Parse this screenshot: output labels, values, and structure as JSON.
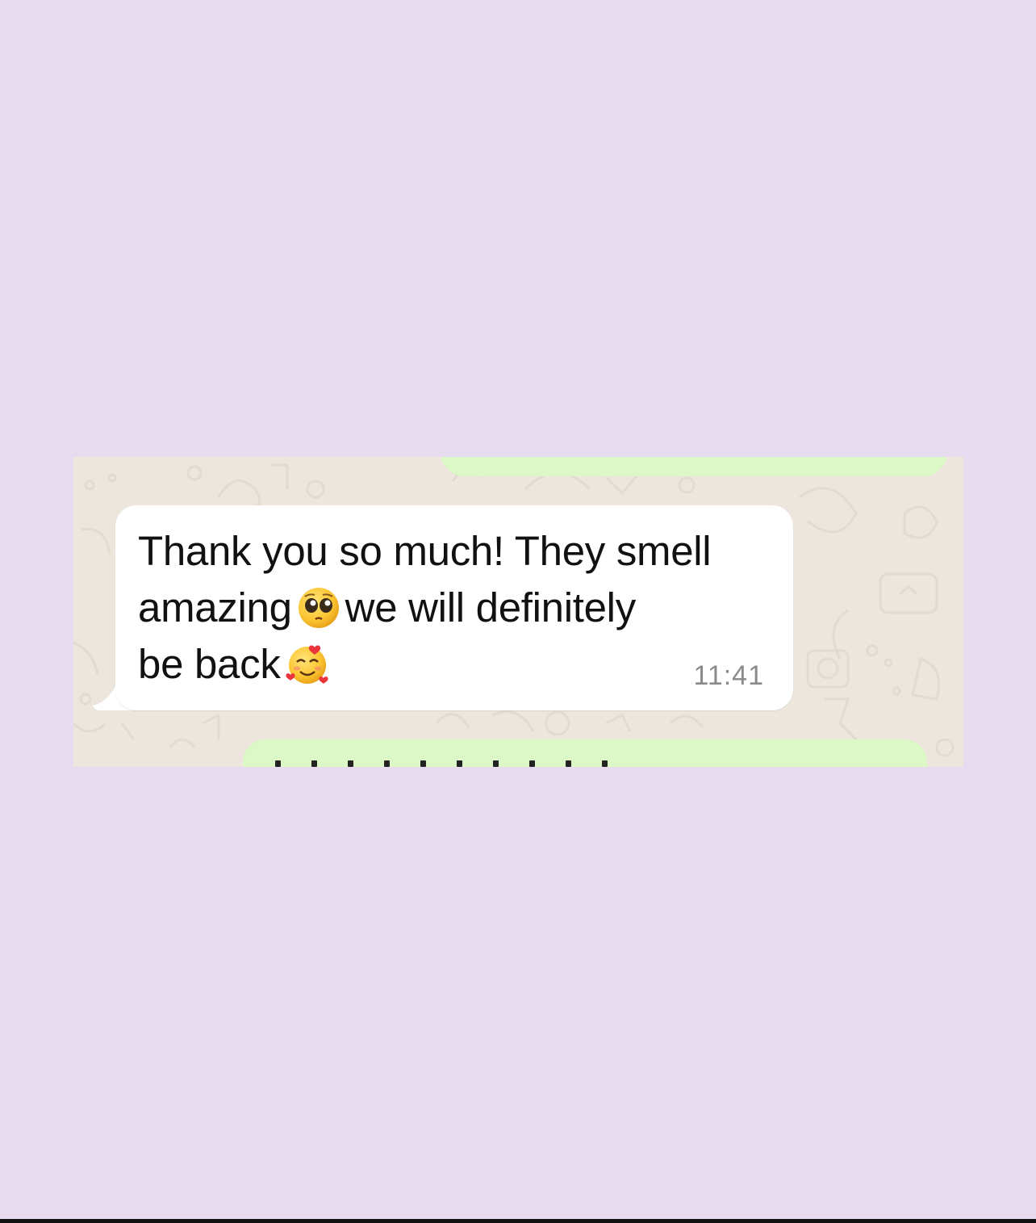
{
  "chat": {
    "message": {
      "line1": "Thank you so much! They smell",
      "line2_before": "amazing",
      "line2_after": "we will definitely",
      "line3": "be back",
      "time": "11:41"
    },
    "emoji": {
      "pleading": "pleading-face",
      "hearts": "smiling-face-with-hearts"
    }
  },
  "colors": {
    "page_background": "#e7dcef",
    "chat_wallpaper": "#ece6dd",
    "incoming_bubble": "#ffffff",
    "outgoing_bubble": "#dcf8c6",
    "timestamp": "#8a8a8a"
  }
}
